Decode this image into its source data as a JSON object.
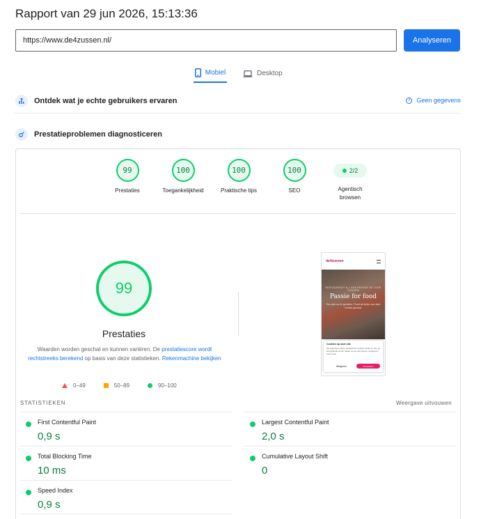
{
  "header": {
    "title": "Rapport van 29 jun 2026, 15:13:36"
  },
  "search": {
    "url_value": "https://www.de4zussen.nl/",
    "analyze_label": "Analyseren"
  },
  "tabs": [
    {
      "label": "Mobiel",
      "active": true
    },
    {
      "label": "Desktop",
      "active": false
    }
  ],
  "sections": {
    "real_users": {
      "title": "Ontdek wat je echte gebruikers ervaren",
      "no_data_label": "Geen gegevens"
    },
    "diagnose": {
      "title": "Prestatieproblemen diagnosticeren"
    }
  },
  "scores": [
    {
      "label": "Prestaties",
      "value": "99"
    },
    {
      "label": "Toegankelijkheid",
      "value": "100"
    },
    {
      "label": "Praktische tips",
      "value": "100"
    },
    {
      "label": "SEO",
      "value": "100"
    },
    {
      "label": "Agentisch browsen",
      "value": "2/2"
    }
  ],
  "performance": {
    "score": "99",
    "label": "Prestaties",
    "desc_pre": "Waarden worden geschat en kunnen variëren. De ",
    "desc_link1": "prestatiescore wordt rechtstreeks berekend",
    "desc_mid": " op basis van deze statistieken. ",
    "desc_link2": "Rekenmachine bekijken"
  },
  "legend": [
    {
      "range": "0–49",
      "color": "#ff4e42"
    },
    {
      "range": "50–89",
      "color": "#ffa400"
    },
    {
      "range": "90–100",
      "color": "#0cce6b"
    }
  ],
  "phone_preview": {
    "logo": "de4zussen",
    "kicker": "RESTAURANT & LUNCHROOM DE VIER ZUSSEN",
    "heading": "Passie for food",
    "sub": "Een plek om te genieten. Proef de liefde voor eten in ieder gerecht.",
    "cookie_title": "Cookies op onze site",
    "cookie_text": "We gebruiken alleen analytische cookies zodat we hoe de site gebruikt wordt. Indien we de site kunnen verbeteren. Lees meer",
    "cookie_deny": "Weigeren",
    "cookie_accept": "Accepteren"
  },
  "stats": {
    "header": "STATISTIEKEN",
    "expand_label": "Weergave uitvouwen",
    "metrics": [
      {
        "label": "First Contentful Paint",
        "value": "0,9 s"
      },
      {
        "label": "Largest Contentful Paint",
        "value": "2,0 s"
      },
      {
        "label": "Total Blocking Time",
        "value": "10 ms"
      },
      {
        "label": "Cumulative Layout Shift",
        "value": "0"
      },
      {
        "label": "Speed Index",
        "value": "0,9 s"
      }
    ]
  },
  "colors": {
    "accent": "#1a73e8",
    "pass": "#0cce6b",
    "pass_text": "#0a7e3e"
  }
}
